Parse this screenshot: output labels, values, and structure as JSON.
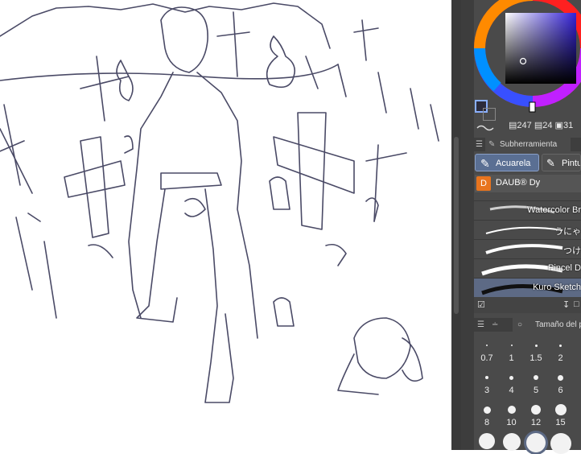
{
  "color_panel": {
    "values": {
      "hsv": "247",
      "s_val": "24",
      "v_val": "31"
    }
  },
  "subtool_panel": {
    "tab_label": "Subherramienta",
    "tools": [
      {
        "label": "Acuarela",
        "selected": true
      },
      {
        "label": "Pintu",
        "selected": false
      }
    ],
    "group_label": "DAUB® Dy"
  },
  "brushes": [
    {
      "name": "Watercolor Br"
    },
    {
      "name": "うにゃ"
    },
    {
      "name": "つけ"
    },
    {
      "name": "Pincel D"
    },
    {
      "name": "Kuro Sketch",
      "selected": true
    }
  ],
  "brush_size_panel": {
    "tab_label": "Tamaño del p",
    "sizes": [
      "0.7",
      "1",
      "1.5",
      "2",
      "3",
      "4",
      "5",
      "6",
      "8",
      "10",
      "12",
      "15"
    ]
  },
  "colors": {
    "panel_bg": "#4a4a4a",
    "selected_tool": "#5a6f93",
    "selected_brush": "#5d6a85",
    "daub_orange": "#e8741e",
    "sketch_line": "#4a4a66"
  }
}
